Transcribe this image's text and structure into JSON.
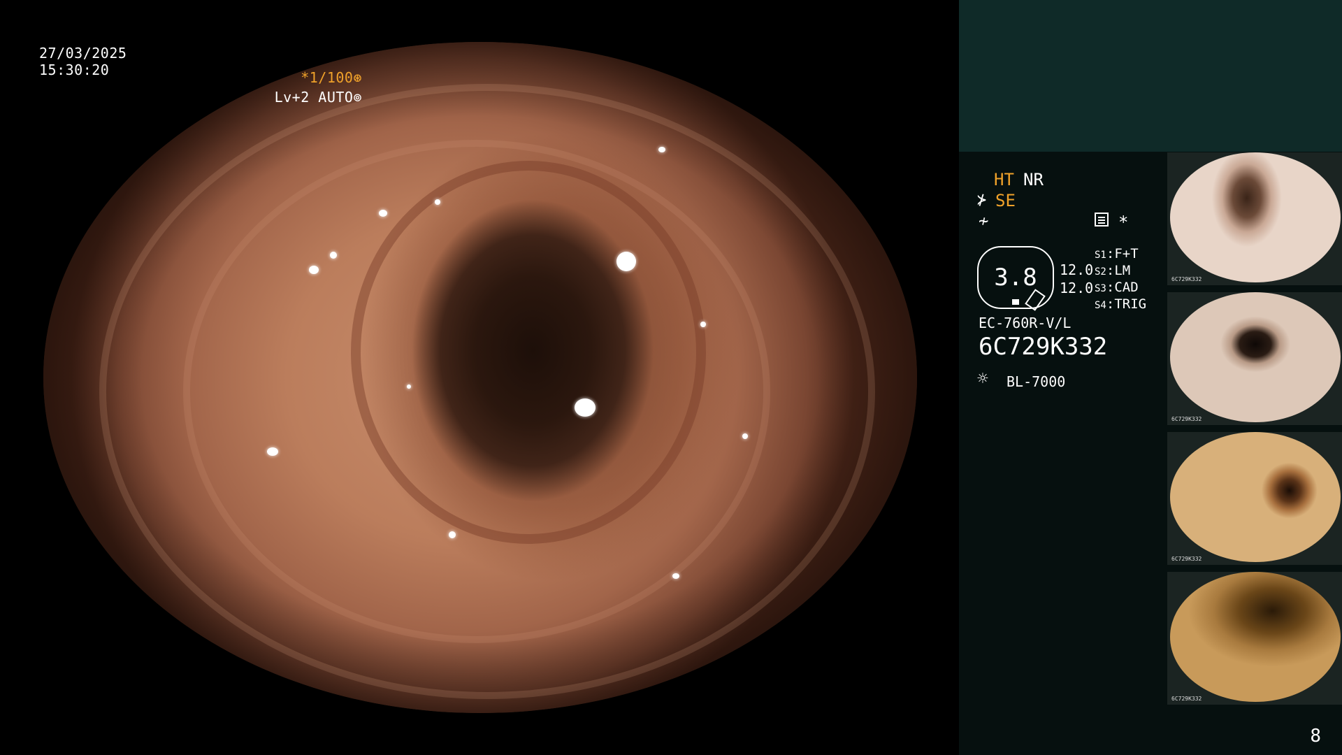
{
  "osd": {
    "date": "27/03/2025",
    "time": "15:30:20",
    "freeze": "*1/100⊛",
    "level": "Lv+2 AUTO⊚"
  },
  "panel": {
    "ht": "HT",
    "nr": "NR",
    "se_icon": "⊁",
    "se": "SE",
    "enhance_icon": "≁",
    "menu_icon": "menu-icon",
    "asterisk": "*",
    "gauge_value": "3.8",
    "s_values": [
      "12.0",
      "12.0"
    ],
    "switches": [
      {
        "key": "S1",
        "label": "F+T"
      },
      {
        "key": "S2",
        "label": "LM"
      },
      {
        "key": "S3",
        "label": "CAD"
      },
      {
        "key": "S4",
        "label": "TRIG"
      }
    ],
    "scope_model": "EC-760R-V/L",
    "serial": "6C729K332",
    "light_icon": "☼",
    "light_source": "BL-7000"
  },
  "thumbnails": [
    {
      "caption": "6C729K332"
    },
    {
      "caption": "6C729K332"
    },
    {
      "caption": "6C729K332"
    },
    {
      "caption": "6C729K332"
    }
  ],
  "page_number": "8",
  "colors": {
    "accent": "#f0a22a",
    "panel_bg": "#06100f",
    "panel_top": "#0f2a28"
  }
}
